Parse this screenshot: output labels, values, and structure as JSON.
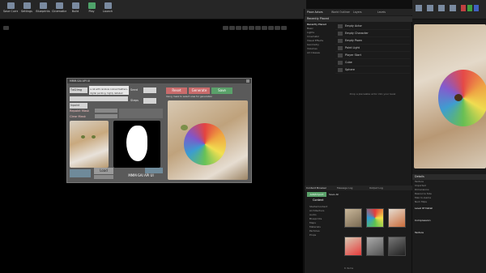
{
  "toolbar": {
    "buttons": [
      {
        "label": "Save Current"
      },
      {
        "label": "Settings"
      },
      {
        "label": "Blueprints"
      },
      {
        "label": "Cinematics"
      },
      {
        "label": "Build"
      },
      {
        "label": "Play"
      },
      {
        "label": "Launch"
      }
    ],
    "tabs": [
      "Place Actors",
      "World Outliner",
      "Layers",
      "Levels"
    ]
  },
  "dialog": {
    "title": "MMM-SAI API UI",
    "combo_value": "Txt2Img",
    "prompt_text": "a cat with rainbow colored feathers, digital painting, highly detailed",
    "inpaint_label": "Inpaint",
    "seed_label": "Seed",
    "steps_label": "Steps",
    "repaint_label": "Repaint Mask",
    "clear_label": "Clear Mask",
    "reset_label": "Reset",
    "generate_label": "Generate",
    "save_label": "Save",
    "load_label": "Load",
    "footer_label": "MMM-SAI API UI",
    "status_text": "Using mask to select area for generation"
  },
  "panel_place": {
    "header": "Recently Placed",
    "categories": [
      "Recently Placed",
      "Basic",
      "Lights",
      "Cinematic",
      "Visual Effects",
      "Geometry",
      "Volumes",
      "All Classes"
    ],
    "items": [
      "Empty Actor",
      "Empty Character",
      "Empty Pawn",
      "Point Light",
      "Player Start",
      "Cube",
      "Sphere"
    ],
    "search_text": "Drop a placeable actor into your level"
  },
  "content_browser": {
    "tabs": [
      "Content Browser",
      "Message Log",
      "Output Log"
    ],
    "add_label": "Add/Import",
    "save_all_label": "Save All",
    "folder_root": "Content",
    "folders": [
      "StarterContent",
      "Architecture",
      "Audio",
      "Blueprints",
      "Maps",
      "Materials",
      "Particles",
      "Props",
      "Shapes",
      "Textures"
    ],
    "item_count": "6 items"
  },
  "details": {
    "tab_label": "Details",
    "rows": [
      "Texture",
      "Imported",
      "Dimensions",
      "Resource Size",
      "Max In-Game",
      "Num Mips"
    ],
    "section_levelofdetail": "Level Of Detail",
    "section_compression": "Compression",
    "section_texture": "Texture"
  },
  "colors": {
    "reset": "#c96b6b",
    "generate": "#c96b6b",
    "save": "#5aa16a",
    "accent": "#2f7ad6"
  }
}
